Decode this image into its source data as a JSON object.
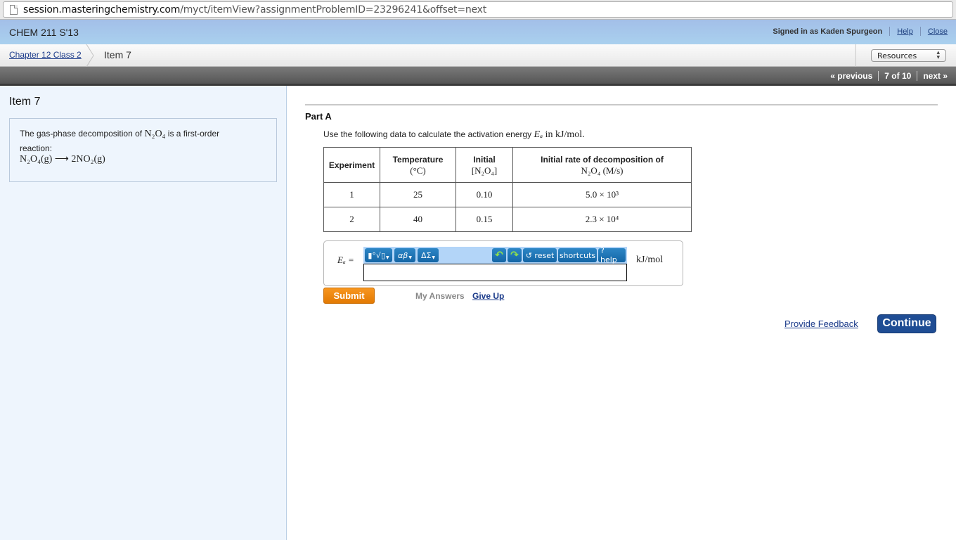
{
  "browser": {
    "url_host": "session.masteringchemistry.com",
    "url_path": "/myct/itemView?assignmentProblemID=23296241&offset=next"
  },
  "header": {
    "course": "CHEM 211 S'13",
    "signed_in": "Signed in as Kaden Spurgeon",
    "help_link": "Help",
    "close_link": "Close"
  },
  "breadcrumb": {
    "parent": "Chapter 12 Class 2",
    "current": "Item 7",
    "resources_select": "Resources"
  },
  "pager": {
    "previous": "« previous",
    "position": "7 of 10",
    "next": "next »"
  },
  "sidebar": {
    "title": "Item 7",
    "problem_text_a": "The gas-phase decomposition of ",
    "problem_species": "N₂O₄",
    "problem_text_b": " is a first-order",
    "problem_text_c": "reaction:",
    "equation": "N₂O₄(g) ⟶ 2NO₂(g)"
  },
  "part": {
    "title": "Part A",
    "instruction_a": "Use the following data to calculate the activation energy ",
    "instruction_var": "Eₐ",
    "instruction_b": " in kJ/mol."
  },
  "table": {
    "headers": [
      {
        "main": "Experiment",
        "sub": ""
      },
      {
        "main": "Temperature",
        "sub": "(°C)"
      },
      {
        "main": "Initial",
        "sub": "[N₂O₄]"
      },
      {
        "main": "Initial rate of decomposition of",
        "sub": "N₂O₄ (M/s)"
      }
    ],
    "rows": [
      {
        "experiment": "1",
        "temperature": "25",
        "initial_conc": "0.10",
        "rate": "5.0 × 10³"
      },
      {
        "experiment": "2",
        "temperature": "40",
        "initial_conc": "0.15",
        "rate": "2.3 × 10⁴"
      }
    ]
  },
  "answer": {
    "label": "Eₐ =",
    "value": "",
    "unit": "kJ/mol",
    "toolbar": {
      "templates": "▮°√▯",
      "greek_lower": "αβ",
      "greek_upper": "ΔΣ",
      "undo": "↶",
      "redo": "↷",
      "reset": "↺ reset",
      "shortcuts": "shortcuts",
      "help": "? help"
    }
  },
  "actions": {
    "submit": "Submit",
    "my_answers": "My Answers",
    "give_up": "Give Up",
    "provide_feedback": "Provide Feedback",
    "continue": "Continue"
  }
}
